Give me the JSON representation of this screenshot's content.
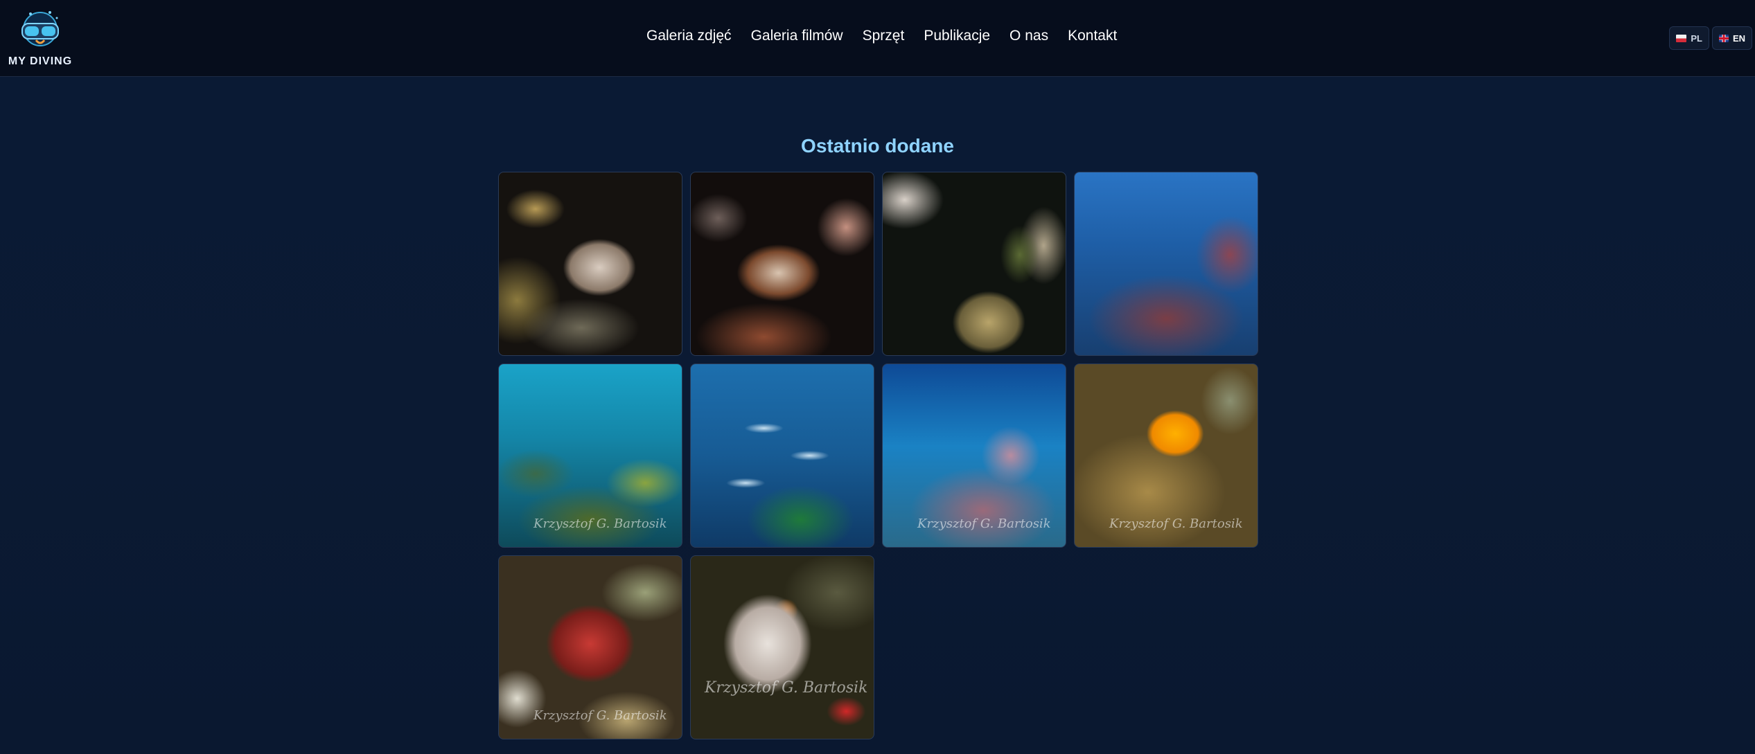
{
  "header": {
    "logo_text": "MY DIVING",
    "nav": [
      {
        "label": "Galeria zdjęć"
      },
      {
        "label": "Galeria filmów"
      },
      {
        "label": "Sprzęt"
      },
      {
        "label": "Publikacje"
      },
      {
        "label": "O nas"
      },
      {
        "label": "Kontakt"
      }
    ],
    "languages": [
      {
        "code": "PL",
        "flag": "flag-pl-icon"
      },
      {
        "code": "EN",
        "flag": "flag-uk-icon",
        "active": true
      }
    ]
  },
  "recent": {
    "title": "Ostatnio dodane",
    "photos_count": 10,
    "signature_text": "Krzysztof G. Bartosik"
  },
  "colors": {
    "background": "#0b1a33",
    "header": "#060d1c",
    "title_accent": "#8fd3ff"
  }
}
